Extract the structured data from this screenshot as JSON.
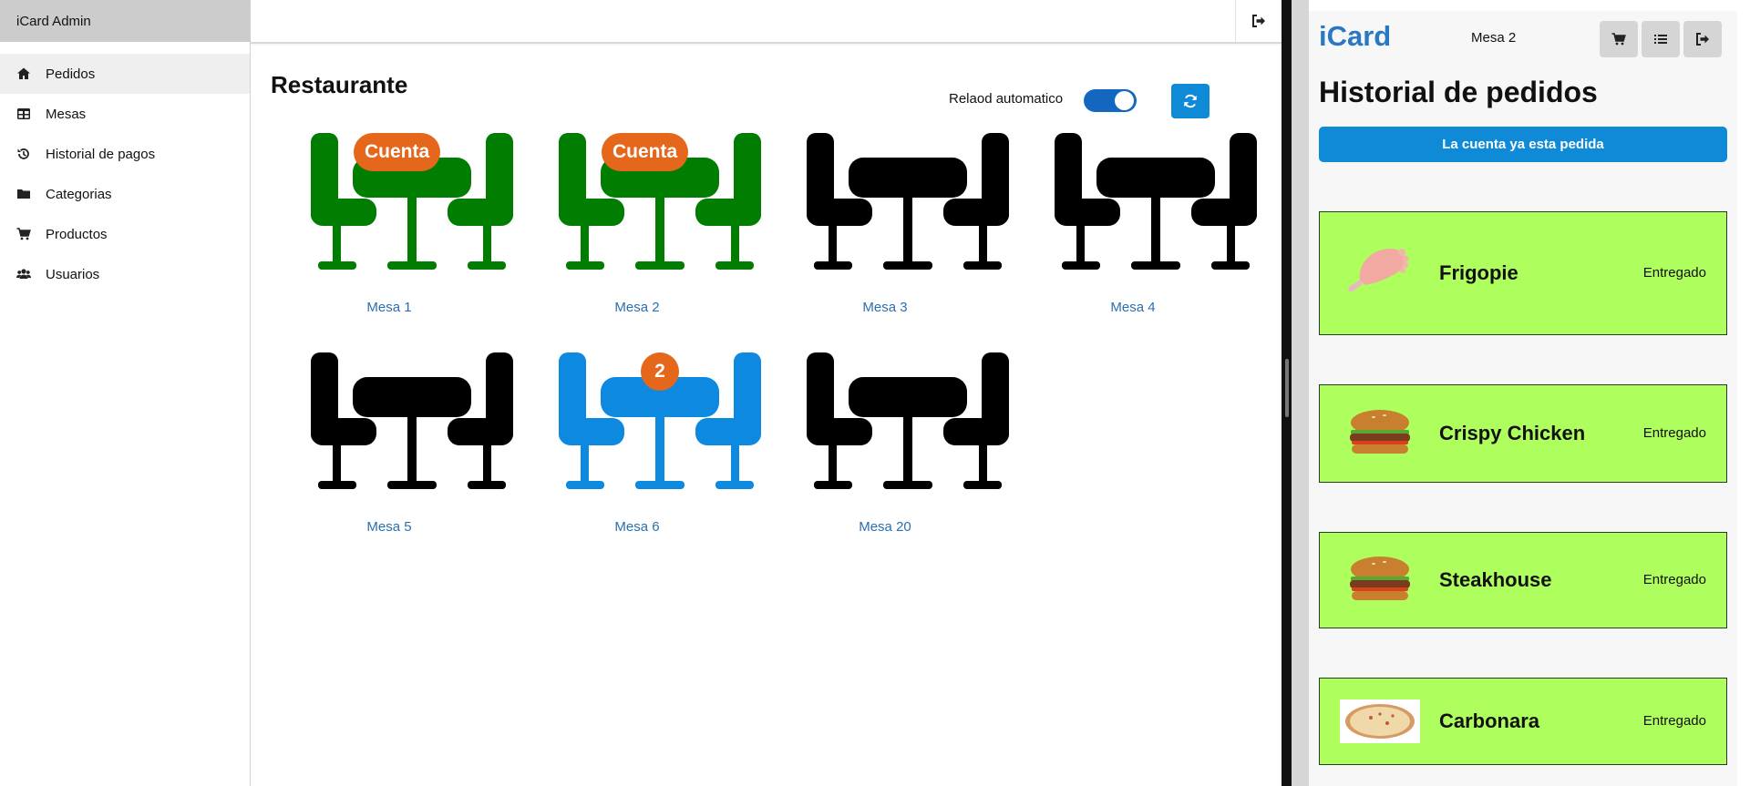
{
  "admin": {
    "brand": "iCard Admin",
    "menu": [
      {
        "label": "Pedidos",
        "icon": "home-icon"
      },
      {
        "label": "Mesas",
        "icon": "table-grid-icon"
      },
      {
        "label": "Historial de pagos",
        "icon": "history-icon"
      },
      {
        "label": "Categorias",
        "icon": "folder-icon"
      },
      {
        "label": "Productos",
        "icon": "cart-icon"
      },
      {
        "label": "Usuarios",
        "icon": "users-icon"
      }
    ],
    "topbar": {
      "logout_icon": "sign-out-icon"
    }
  },
  "restaurant": {
    "title": "Restaurante",
    "autoreload_label": "Relaod automatico",
    "autoreload_on": true,
    "refresh_icon": "refresh-icon",
    "tables": [
      {
        "label": "Mesa 1",
        "color": "#017d01",
        "badge": "Cuenta"
      },
      {
        "label": "Mesa 2",
        "color": "#017d01",
        "badge": "Cuenta"
      },
      {
        "label": "Mesa 3",
        "color": "#000000",
        "badge": ""
      },
      {
        "label": "Mesa 4",
        "color": "#000000",
        "badge": ""
      },
      {
        "label": "Mesa 5",
        "color": "#000000",
        "badge": ""
      },
      {
        "label": "Mesa 6",
        "color": "#0d8ae0",
        "badge": "2"
      },
      {
        "label": "Mesa 20",
        "color": "#000000",
        "badge": ""
      }
    ]
  },
  "client": {
    "logo": "iCard",
    "mesa": "Mesa 2",
    "nav_icons": [
      "cart-icon",
      "list-icon",
      "sign-out-icon"
    ],
    "title": "Historial de pedidos",
    "cuenta_button": "La cuenta ya esta pedida",
    "orders": [
      {
        "name": "Frigopie",
        "status": "Entregado",
        "image": "ice-cream-foot"
      },
      {
        "name": "Crispy Chicken",
        "status": "Entregado",
        "image": "burger"
      },
      {
        "name": "Steakhouse",
        "status": "Entregado",
        "image": "burger"
      },
      {
        "name": "Carbonara",
        "status": "Entregado",
        "image": "pizza"
      }
    ]
  },
  "colors": {
    "accent": "#0f8ad6",
    "badge": "#e4671b",
    "order_bg": "#aeff5e",
    "link": "#2a6fb0"
  }
}
